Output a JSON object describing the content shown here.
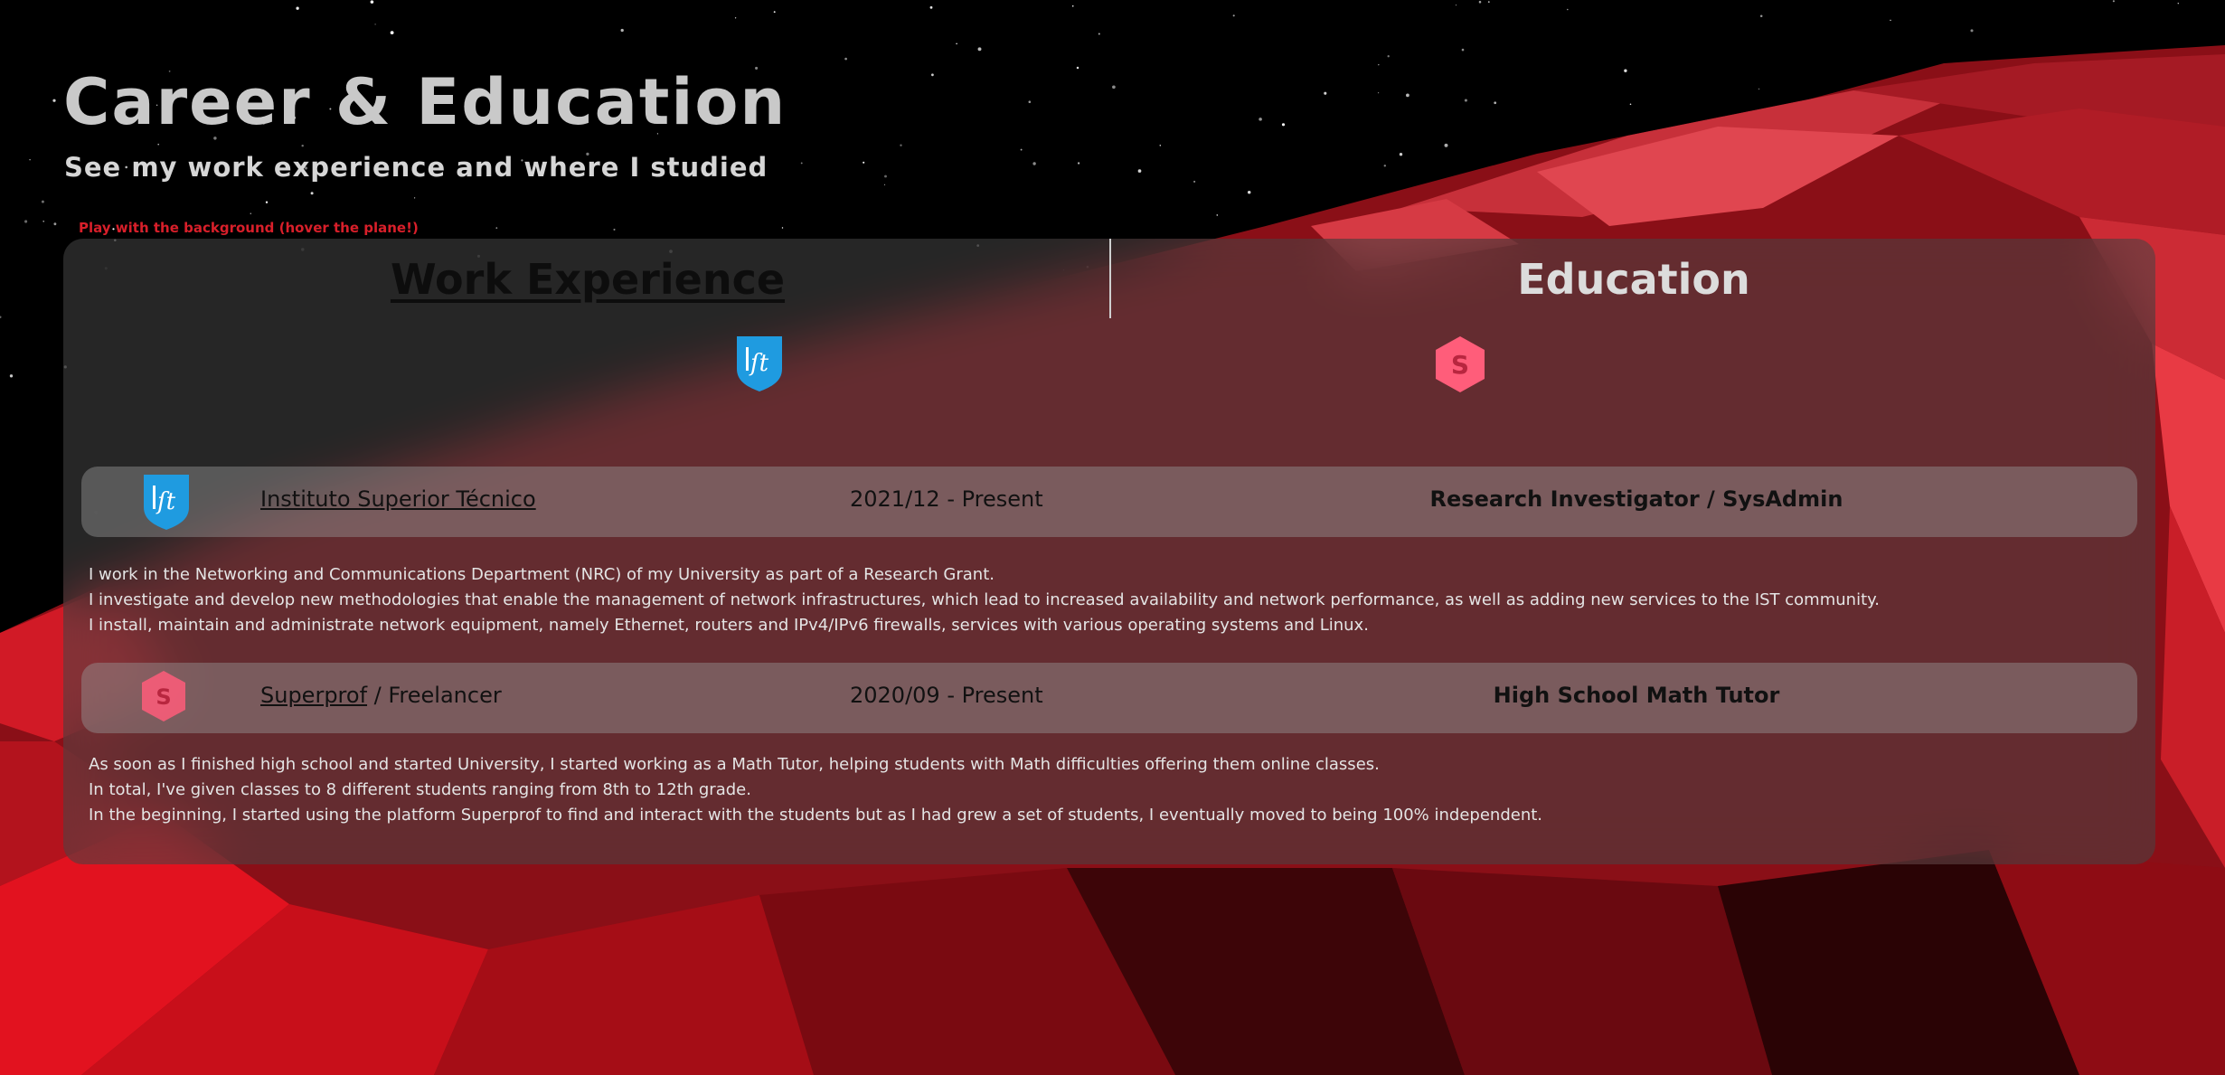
{
  "header": {
    "title": "Career & Education",
    "subtitle": "See my work experience and where I studied",
    "hint": "Play with the background (hover the plane!)"
  },
  "tabs": {
    "work": "Work Experience",
    "education": "Education"
  },
  "icons": {
    "ist": "ist-logo-icon",
    "superprof": "superprof-logo-icon"
  },
  "colors": {
    "ist_blue": "#1f9be0",
    "superprof_pink": "#ff5d7a",
    "hint_red": "#d81f2a"
  },
  "jobs": [
    {
      "company": "Instituto Superior Técnico",
      "company_suffix": "",
      "dates": "2021/12 - Present",
      "role": "Research Investigator / SysAdmin",
      "description": [
        "I work in the Networking and Communications Department (NRC) of my University as part of a Research Grant.",
        "I investigate and develop new methodologies that enable the management of network infrastructures, which lead to increased availability and network performance, as well as adding new services to the IST community.",
        "I install, maintain and administrate network equipment, namely Ethernet, routers and IPv4/IPv6 firewalls, services with various operating systems and Linux."
      ]
    },
    {
      "company": "Superprof",
      "company_suffix": " / Freelancer",
      "dates": "2020/09 - Present",
      "role": "High School Math Tutor",
      "description": [
        "As soon as I finished high school and started University, I started working as a Math Tutor, helping students with Math difficulties offering them online classes.",
        "In total, I've given classes to 8 different students ranging from 8th to 12th grade.",
        "In the beginning, I started using the platform Superprof to find and interact with the students but as I had grew a set of students, I eventually moved to being 100% independent."
      ]
    }
  ]
}
